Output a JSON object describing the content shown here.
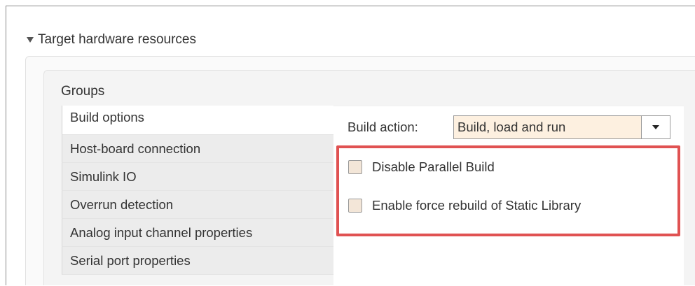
{
  "section": {
    "title": "Target hardware resources"
  },
  "groups": {
    "label": "Groups",
    "items": [
      {
        "label": "Build options",
        "selected": true
      },
      {
        "label": "Host-board connection"
      },
      {
        "label": "Simulink IO"
      },
      {
        "label": "Overrun detection"
      },
      {
        "label": "Analog input channel properties"
      },
      {
        "label": "Serial port properties"
      }
    ]
  },
  "build_options": {
    "build_action_label": "Build action:",
    "build_action_value": "Build, load and run",
    "checkboxes": [
      {
        "label": "Disable Parallel Build",
        "checked": false
      },
      {
        "label": "Enable force rebuild of Static Library",
        "checked": false
      }
    ]
  },
  "colors": {
    "highlight": "#e05252",
    "field_bg": "#fdf0e0"
  }
}
